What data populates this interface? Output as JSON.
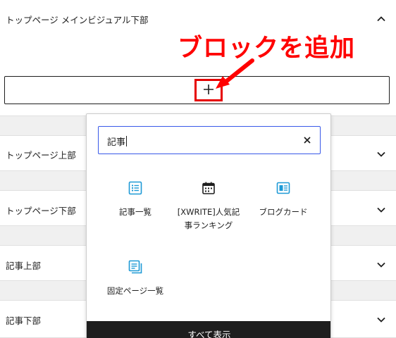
{
  "annotation": {
    "text": "ブロックを追加",
    "color": "#ff0000"
  },
  "top_panel": {
    "title": "トップページ メインビジュアル下部",
    "icon": "chevron-up-icon"
  },
  "panels": [
    {
      "title": "トップページ上部",
      "icon": "chevron-down-icon"
    },
    {
      "title": "トップページ下部",
      "icon": "chevron-down-icon"
    },
    {
      "title": "記事上部",
      "icon": "chevron-down-icon"
    },
    {
      "title": "記事下部",
      "icon": "chevron-down-icon"
    }
  ],
  "appender": {
    "icon": "plus-icon"
  },
  "inserter": {
    "search": {
      "value": "記事",
      "clear_icon": "close-icon"
    },
    "blocks": [
      {
        "label": "記事一覧",
        "icon": "list-icon"
      },
      {
        "label": "[XWRITE]人気記事ランキング",
        "icon": "calendar-icon"
      },
      {
        "label": "ブログカード",
        "icon": "card-icon"
      },
      {
        "label": "固定ページ一覧",
        "icon": "pages-icon"
      }
    ],
    "footer_label": "すべて表示"
  },
  "colors": {
    "accent": "#3858e9",
    "block_icon": "#1e9ad6",
    "footer_bg": "#1e1e1e"
  }
}
